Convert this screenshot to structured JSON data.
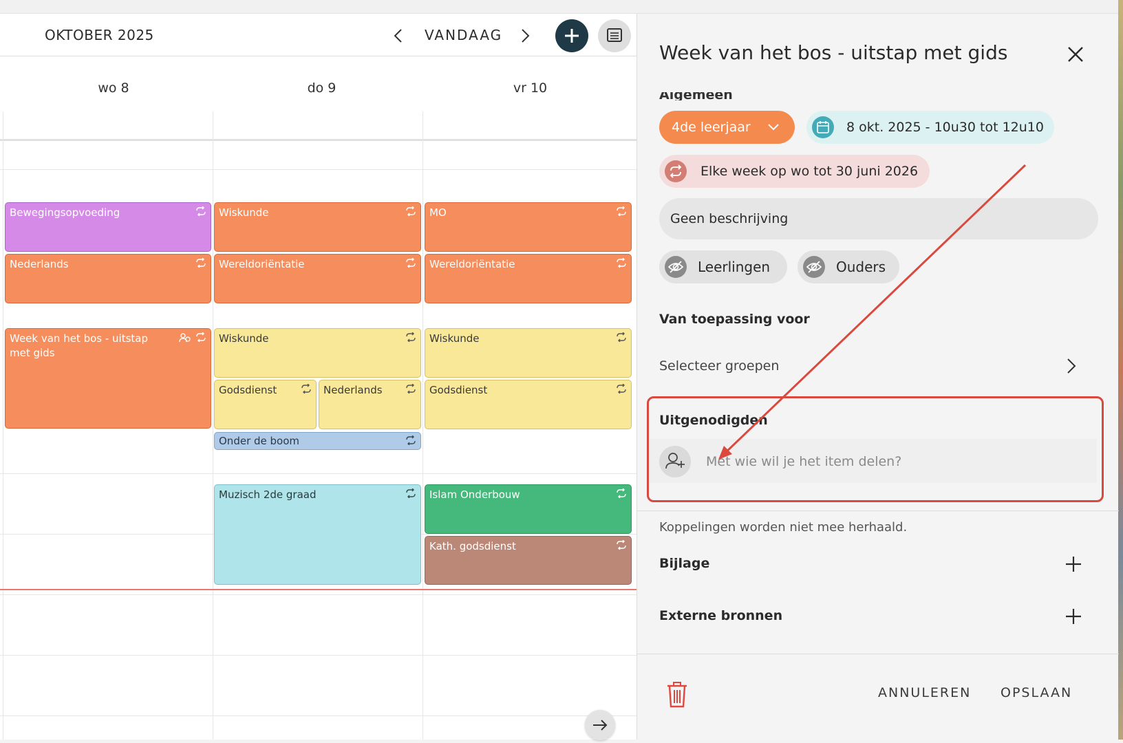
{
  "calendar": {
    "month": "OKTOBER 2025",
    "today_label": "VANDAAG",
    "days": [
      "wo 8",
      "do 9",
      "vr 10"
    ],
    "events": {
      "e1": "Bewegingsopvoeding",
      "e2": "Wiskunde",
      "e3": "MO",
      "e4": "Nederlands",
      "e5": "Wereldoriëntatie",
      "e6": "Wereldoriëntatie",
      "e7": "Week van het bos - uitstap met gids",
      "e8": "Wiskunde",
      "e9": "Wiskunde",
      "e10": "Godsdienst",
      "e11": "Nederlands",
      "e12": "Godsdienst",
      "e13": "Onder de boom",
      "e14": "Muzisch 2de graad",
      "e15": "Islam Onderbouw",
      "e16": "Kath. godsdienst"
    }
  },
  "panel": {
    "title": "Week van het bos - uitstap met gids",
    "cut_heading": "Algemeen",
    "class_chip": "4de leerjaar",
    "date_chip": "8 okt. 2025 - 10u30 tot 12u10",
    "repeat_chip": "Elke week op wo tot 30 juni 2026",
    "description": "Geen beschrijving",
    "visibility": [
      "Leerlingen",
      "Ouders"
    ],
    "applies_label": "Van toepassing voor",
    "select_groups": "Selecteer groepen",
    "invited_label": "Uitgenodigden",
    "invite_placeholder": "Met wie wil je het item delen?",
    "links_note": "Koppelingen worden niet mee herhaald.",
    "attachment_label": "Bijlage",
    "external_label": "Externe bronnen",
    "cancel_label": "ANNULEREN",
    "save_label": "OPSLAAN"
  },
  "colors": {
    "accent_dark": "#1f3a46",
    "class_orange": "#f58a4f",
    "highlight_red": "#d9493e"
  }
}
